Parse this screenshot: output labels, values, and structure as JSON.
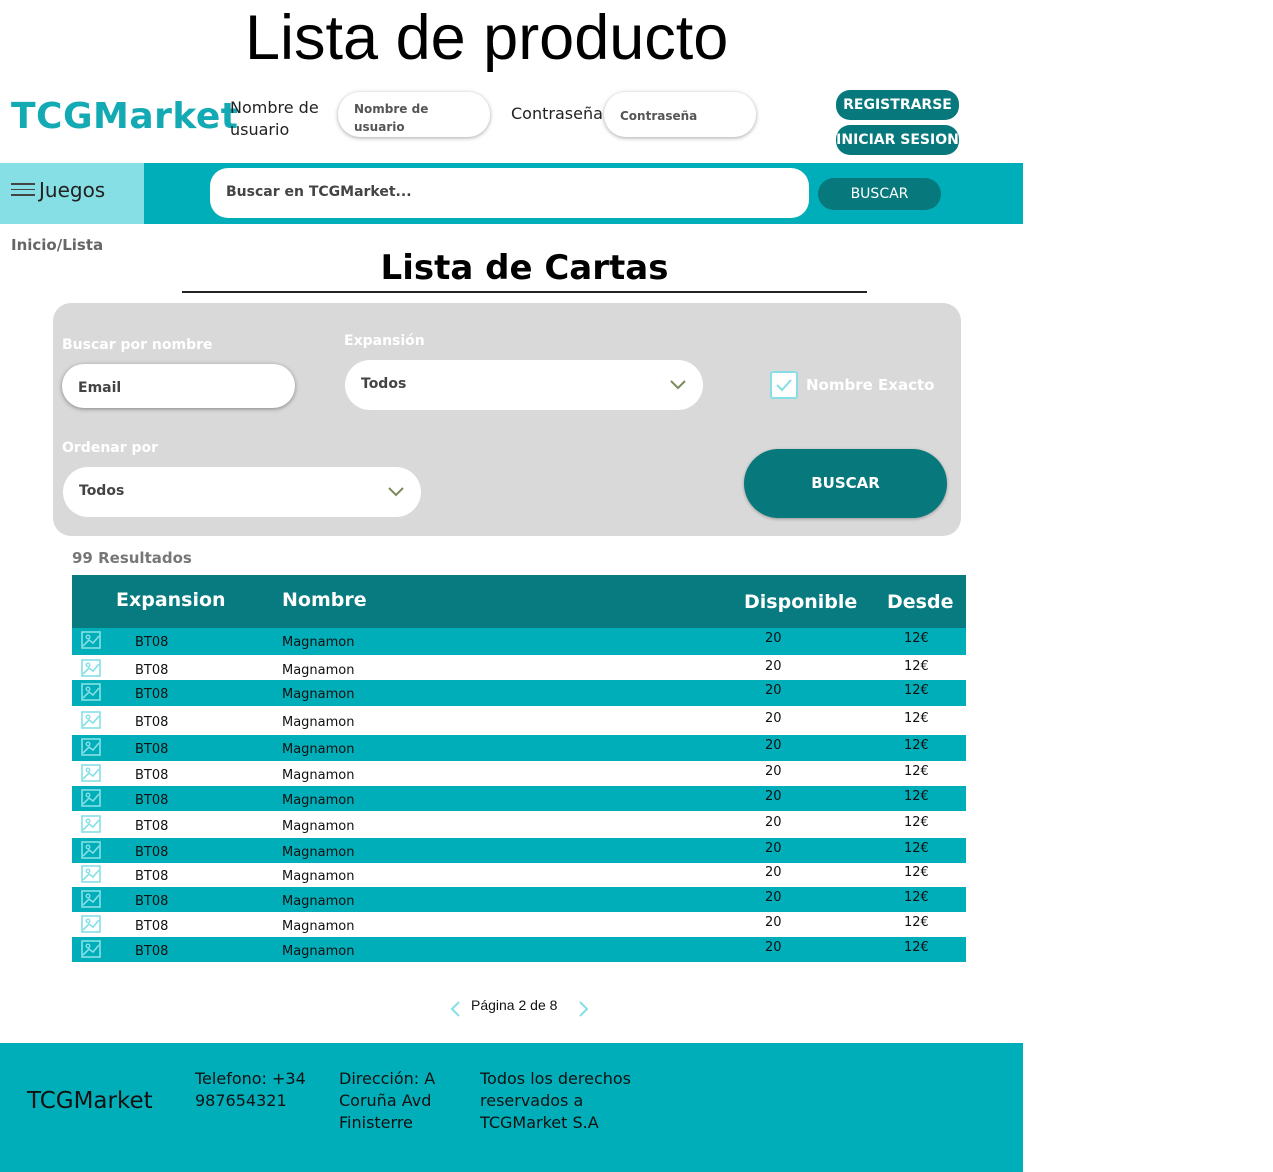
{
  "page_heading": "Lista de producto",
  "header": {
    "brand": "TCGMarket",
    "username_label": "Nombre de usuario",
    "username_placeholder": "Nombre de usuario",
    "password_label": "Contraseña:",
    "password_placeholder": "Contraseña",
    "register_button": "REGISTRARSE",
    "login_button": "INICIAR SESION"
  },
  "navbar": {
    "games_label": "Juegos",
    "search_placeholder": "Buscar en TCGMarket...",
    "search_button": "BUSCAR"
  },
  "breadcrumb": "Inicio/Lista",
  "section_title": "Lista de Cartas",
  "filters": {
    "name_label": "Buscar por nombre",
    "name_placeholder": "Email",
    "expansion_label": "Expansión",
    "expansion_value": "Todos",
    "exact_name_label": "Nombre Exacto",
    "exact_name_checked": true,
    "order_label": "Ordenar por",
    "order_value": "Todos",
    "search_button": "BUSCAR"
  },
  "results_count": "99 Resultados",
  "table": {
    "headers": [
      "Expansion",
      "Nombre",
      "Disponible",
      "Desde"
    ],
    "rows": [
      {
        "expansion": "BT08",
        "name": "Magnamon",
        "available": "20",
        "price": "12€"
      },
      {
        "expansion": "BT08",
        "name": "Magnamon",
        "available": "20",
        "price": "12€"
      },
      {
        "expansion": "BT08",
        "name": "Magnamon",
        "available": "20",
        "price": "12€"
      },
      {
        "expansion": "BT08",
        "name": "Magnamon",
        "available": "20",
        "price": "12€"
      },
      {
        "expansion": "BT08",
        "name": "Magnamon",
        "available": "20",
        "price": "12€"
      },
      {
        "expansion": "BT08",
        "name": "Magnamon",
        "available": "20",
        "price": "12€"
      },
      {
        "expansion": "BT08",
        "name": "Magnamon",
        "available": "20",
        "price": "12€"
      },
      {
        "expansion": "BT08",
        "name": "Magnamon",
        "available": "20",
        "price": "12€"
      },
      {
        "expansion": "BT08",
        "name": "Magnamon",
        "available": "20",
        "price": "12€"
      },
      {
        "expansion": "BT08",
        "name": "Magnamon",
        "available": "20",
        "price": "12€"
      },
      {
        "expansion": "BT08",
        "name": "Magnamon",
        "available": "20",
        "price": "12€"
      },
      {
        "expansion": "BT08",
        "name": "Magnamon",
        "available": "20",
        "price": "12€"
      },
      {
        "expansion": "BT08",
        "name": "Magnamon",
        "available": "20",
        "price": "12€"
      }
    ]
  },
  "pagination": {
    "text": "Página 2 de 8"
  },
  "footer": {
    "brand": "TCGMarket",
    "phone": "Telefono: +34 987654321",
    "address": "Dirección: A Coruña Avd Finisterre",
    "rights": "Todos los derechos reservados a TCGMarket S.A"
  },
  "colors": {
    "brand": "#14aab4",
    "teal": "#00aeb9",
    "dark_teal": "#07787c",
    "light_teal": "#86dfe5",
    "panel_gray": "#d9d9d9"
  }
}
